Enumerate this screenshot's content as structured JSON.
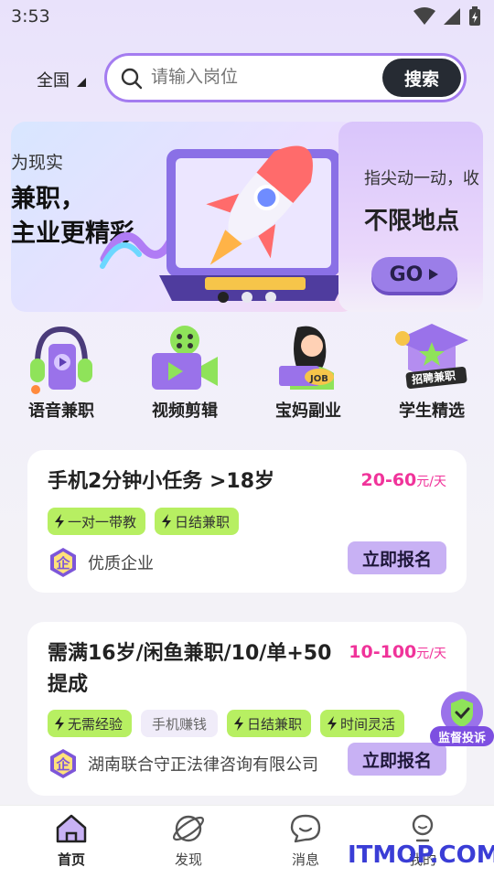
{
  "status_bar": {
    "time": "3:53"
  },
  "search": {
    "region": "全国",
    "placeholder": "请输入岗位",
    "button_label": "搜索"
  },
  "banners": {
    "main": {
      "line1": "为现实",
      "line2": "兼职，",
      "line3": "主业更精彩"
    },
    "second": {
      "subtitle": "指尖动一动，收",
      "headline": "不限地点",
      "button_label": "GO"
    },
    "dot_count": 3,
    "active_dot": 1
  },
  "categories": [
    {
      "label": "语音兼职",
      "icon": "headphones-phone-icon"
    },
    {
      "label": "视频剪辑",
      "icon": "video-camera-icon"
    },
    {
      "label": "宝妈副业",
      "icon": "mom-job-icon"
    },
    {
      "label": "学生精选",
      "icon": "graduation-cap-icon",
      "badge": "招聘兼职"
    }
  ],
  "jobs": [
    {
      "title_line1": "手机2分钟小任务 >18岁",
      "title_line2": "",
      "salary": "20-60",
      "salary_unit": "元/天",
      "tags": [
        {
          "text": "一对一带教",
          "style": "highlight"
        },
        {
          "text": "日结兼职",
          "style": "highlight"
        }
      ],
      "company_badge": "企",
      "company": "优质企业",
      "apply_label": "立即报名"
    },
    {
      "title_line1": "需满16岁/闲鱼兼职/10/单+50",
      "title_line2": "提成",
      "salary": "10-100",
      "salary_unit": "元/天",
      "tags": [
        {
          "text": "无需经验",
          "style": "highlight"
        },
        {
          "text": "手机赚钱",
          "style": "plain"
        },
        {
          "text": "日结兼职",
          "style": "highlight"
        },
        {
          "text": "时间灵活",
          "style": "highlight"
        }
      ],
      "company_badge": "企",
      "company": "湖南联合守正法律咨询有限公司",
      "apply_label": "立即报名"
    }
  ],
  "float_badge": {
    "label": "监督投诉"
  },
  "tabbar": [
    {
      "label": "首页",
      "icon": "home-icon",
      "active": true
    },
    {
      "label": "发现",
      "icon": "planet-icon",
      "active": false
    },
    {
      "label": "消息",
      "icon": "chat-bubble-icon",
      "active": false
    },
    {
      "label": "我的",
      "icon": "profile-icon",
      "active": false
    }
  ],
  "watermark": "ITMOP.COM",
  "colors": {
    "accent_purple": "#a47cf0",
    "salary_pink": "#f0339a",
    "tag_green": "#b7ef62",
    "button_purple": "#c8b1f4",
    "search_button": "#262b33"
  }
}
